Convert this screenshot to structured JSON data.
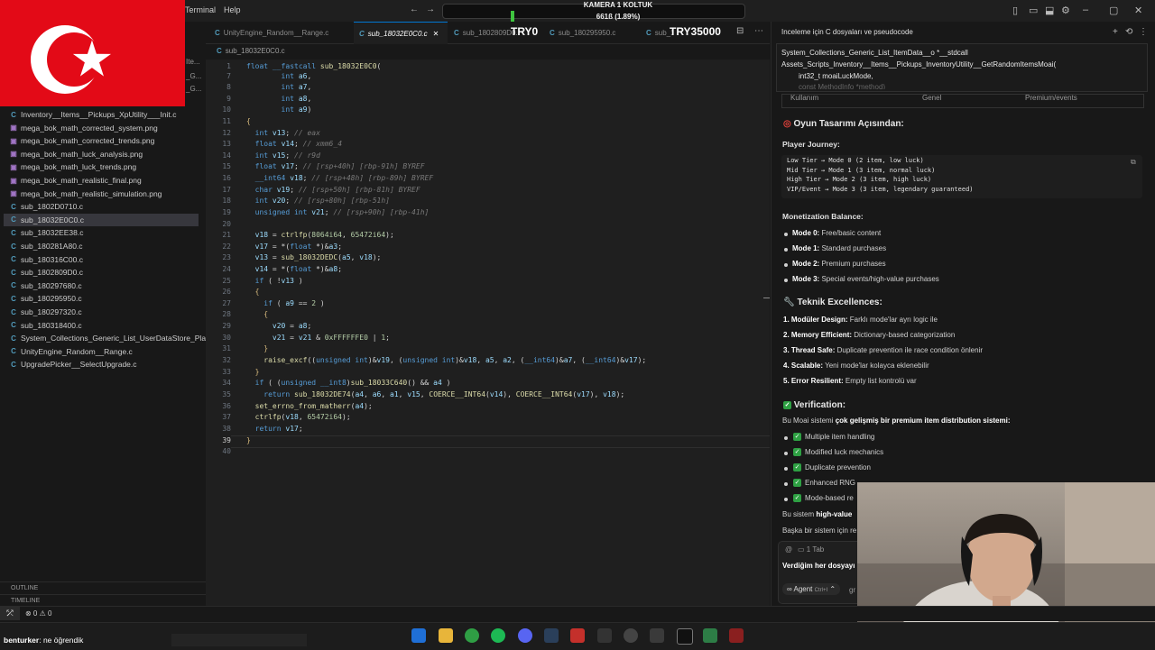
{
  "menu": {
    "terminal": "Terminal",
    "help": "Help"
  },
  "stream": {
    "title": "KAMERA 1 KOLTUK",
    "count": "661ß (1.89%)",
    "progress_fraction": 0.0189
  },
  "overlay": {
    "try0": "TRY0",
    "try35000": "TRY35000"
  },
  "tabs": [
    {
      "label": "UnityEngine_Random__Range.c"
    },
    {
      "label": "sub_18032E0C0.c"
    },
    {
      "label": "sub_1802809D0.c"
    },
    {
      "label": "sub_180295950.c"
    },
    {
      "label": "sub_1802973…"
    }
  ],
  "breadcrumb": "sub_18032E0C0.c",
  "sidebar": {
    "partials": [
      "Ite...",
      "_G...",
      "_G..."
    ],
    "files": [
      {
        "icon": "C",
        "name": "Inventory__Items__Pickups_XpUtility___Init.c",
        "type": "c"
      },
      {
        "icon": "▣",
        "name": "mega_bok_math_corrected_system.png",
        "type": "png"
      },
      {
        "icon": "▣",
        "name": "mega_bok_math_corrected_trends.png",
        "type": "png"
      },
      {
        "icon": "▣",
        "name": "mega_bok_math_luck_analysis.png",
        "type": "png"
      },
      {
        "icon": "▣",
        "name": "mega_bok_math_luck_trends.png",
        "type": "png"
      },
      {
        "icon": "▣",
        "name": "mega_bok_math_realistic_final.png",
        "type": "png"
      },
      {
        "icon": "▣",
        "name": "mega_bok_math_realistic_simulation.png",
        "type": "png"
      },
      {
        "icon": "C",
        "name": "sub_1802D0710.c",
        "type": "c"
      },
      {
        "icon": "C",
        "name": "sub_18032E0C0.c",
        "type": "c",
        "active": true
      },
      {
        "icon": "C",
        "name": "sub_18032EE38.c",
        "type": "c"
      },
      {
        "icon": "C",
        "name": "sub_180281A80.c",
        "type": "c"
      },
      {
        "icon": "C",
        "name": "sub_180316C00.c",
        "type": "c"
      },
      {
        "icon": "C",
        "name": "sub_1802809D0.c",
        "type": "c"
      },
      {
        "icon": "C",
        "name": "sub_180297680.c",
        "type": "c"
      },
      {
        "icon": "C",
        "name": "sub_180295950.c",
        "type": "c"
      },
      {
        "icon": "C",
        "name": "sub_180297320.c",
        "type": "c"
      },
      {
        "icon": "C",
        "name": "sub_180318400.c",
        "type": "c"
      },
      {
        "icon": "C",
        "name": "System_Collections_Generic_List_UserDataStore_Pla...",
        "type": "c"
      },
      {
        "icon": "C",
        "name": "UnityEngine_Random__Range.c",
        "type": "c"
      },
      {
        "icon": "C",
        "name": "UpgradePicker__SelectUpgrade.c",
        "type": "c"
      }
    ],
    "outline": "OUTLINE",
    "timeline": "TIMELINE"
  },
  "status": {
    "problems": "⊗ 0 ⚠ 0"
  },
  "code": {
    "line_numbers": [
      "1",
      "7",
      "8",
      "9",
      "10",
      "11",
      "12",
      "13",
      "14",
      "15",
      "16",
      "17",
      "18",
      "19",
      "20",
      "21",
      "22",
      "23",
      "24",
      "25",
      "26",
      "27",
      "28",
      "29",
      "30",
      "31",
      "32",
      "33",
      "34",
      "35",
      "36",
      "37",
      "38",
      "39",
      "40"
    ]
  },
  "panel": {
    "title": "Inceleme için C dosyaları ve pseudocode",
    "context": [
      "System_Collections_Generic_List_ItemData__o *__stdcall",
      "Assets_Scripts_Inventory__Items__Pickups_InventoryUtility__GetRandomItemsMoai(",
      "int32_t moaiLuckMode,",
      "const MethodInfo *method)"
    ],
    "table_headers": [
      "Kullanım",
      "Genel",
      "Premium/events"
    ],
    "design_heading": "Oyun Tasarımı Açısından:",
    "journey_heading": "Player Journey:",
    "journey_lines": [
      "Low Tier → Mode 0 (2 item, low luck)",
      "Mid Tier → Mode 1 (3 item, normal luck)",
      "High Tier → Mode 2 (3 item, high luck)",
      "VIP/Event → Mode 3 (3 item, legendary guaranteed)"
    ],
    "monetization_heading": "Monetization Balance:",
    "monetization": [
      {
        "k": "Mode 0:",
        "v": "Free/basic content"
      },
      {
        "k": "Mode 1:",
        "v": "Standard purchases"
      },
      {
        "k": "Mode 2:",
        "v": "Premium purchases"
      },
      {
        "k": "Mode 3:",
        "v": "Special events/high-value purchases"
      }
    ],
    "tech_heading": "Teknik Excellences:",
    "tech": [
      {
        "k": "1. Modüler Design:",
        "v": "Farklı mode'lar ayrı logic ile"
      },
      {
        "k": "2. Memory Efficient:",
        "v": "Dictionary-based categorization"
      },
      {
        "k": "3. Thread Safe:",
        "v": "Duplicate prevention ile race condition önlenir"
      },
      {
        "k": "4. Scalable:",
        "v": "Yeni mode'lar kolayca eklenebilir"
      },
      {
        "k": "5. Error Resilient:",
        "v": "Empty list kontrolü var"
      }
    ],
    "verification_heading": "Verification:",
    "verification_intro_a": "Bu Moai sistemi ",
    "verification_intro_b": "çok gelişmiş bir premium item distribution sistemi:",
    "checks": [
      "Multiple item handling",
      "Modified luck mechanics",
      "Duplicate prevention",
      "Enhanced RNG",
      "Mode-based re"
    ],
    "outro_a": "Bu sistem ",
    "outro_b": "high-value",
    "outro2": "Başka bir sistem için re",
    "tab_count": "1 Tab",
    "chat_text": "Verdiğim her dosyayı",
    "agent_label": "Agent",
    "agent_shortcut": "Ctrl+I",
    "model_partial": "gr"
  },
  "chat": {
    "user": "benturker",
    "message": ": ne öğrendik"
  },
  "colors": {
    "flag_red": "#e30a17",
    "accent_blue": "#0078d4",
    "check_green": "#2ea043"
  }
}
